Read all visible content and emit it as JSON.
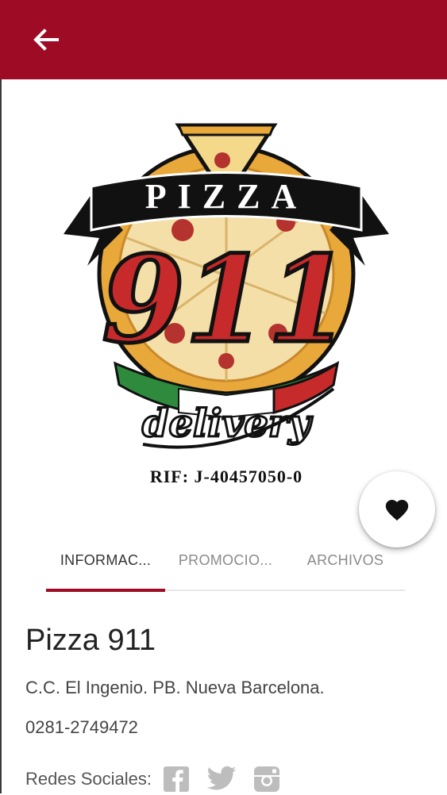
{
  "appbar": {
    "back_icon": "arrow-left-icon",
    "color": "#9e0b24"
  },
  "logo": {
    "banner_text": "PIZZA",
    "number_text": "911",
    "script_text": "delivery",
    "rif_text": "RIF: J-40457050-0"
  },
  "favorite": {
    "icon": "heart-icon"
  },
  "tabs": [
    {
      "label": "INFORMAC...",
      "active": true
    },
    {
      "label": "PROMOCIO...",
      "active": false
    },
    {
      "label": "ARCHIVOS",
      "active": false
    }
  ],
  "place": {
    "name": "Pizza 911",
    "address": "C.C. El Ingenio. PB. Nueva Barcelona.",
    "phone": "0281-2749472"
  },
  "social": {
    "label": "Redes Sociales:",
    "icons": [
      "facebook-icon",
      "twitter-icon",
      "instagram-icon"
    ]
  }
}
